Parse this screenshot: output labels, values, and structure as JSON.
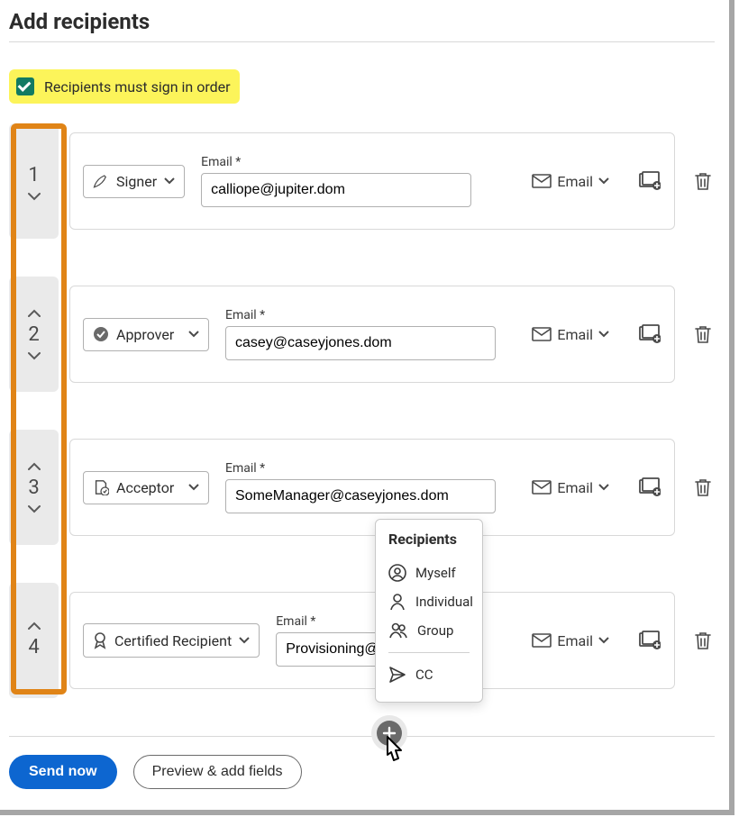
{
  "title": "Add recipients",
  "order_checkbox": {
    "label": "Recipients must sign in order",
    "checked": true
  },
  "email_field_label": "Email *",
  "delivery_label": "Email",
  "recipients": [
    {
      "order": "1",
      "role": "Signer",
      "email": "calliope@jupiter.dom",
      "up": false,
      "down": true
    },
    {
      "order": "2",
      "role": "Approver",
      "email": "casey@caseyjones.dom",
      "up": true,
      "down": true
    },
    {
      "order": "3",
      "role": "Acceptor",
      "email": "SomeManager@caseyjones.dom",
      "up": true,
      "down": true
    },
    {
      "order": "4",
      "role": "Certified Recipient",
      "email": "Provisioning@",
      "up": true,
      "down": false
    }
  ],
  "popover": {
    "title": "Recipients",
    "options": [
      {
        "name": "Myself"
      },
      {
        "name": "Individual"
      },
      {
        "name": "Group"
      }
    ],
    "cc": "CC"
  },
  "buttons": {
    "primary": "Send now",
    "secondary": "Preview & add fields"
  }
}
